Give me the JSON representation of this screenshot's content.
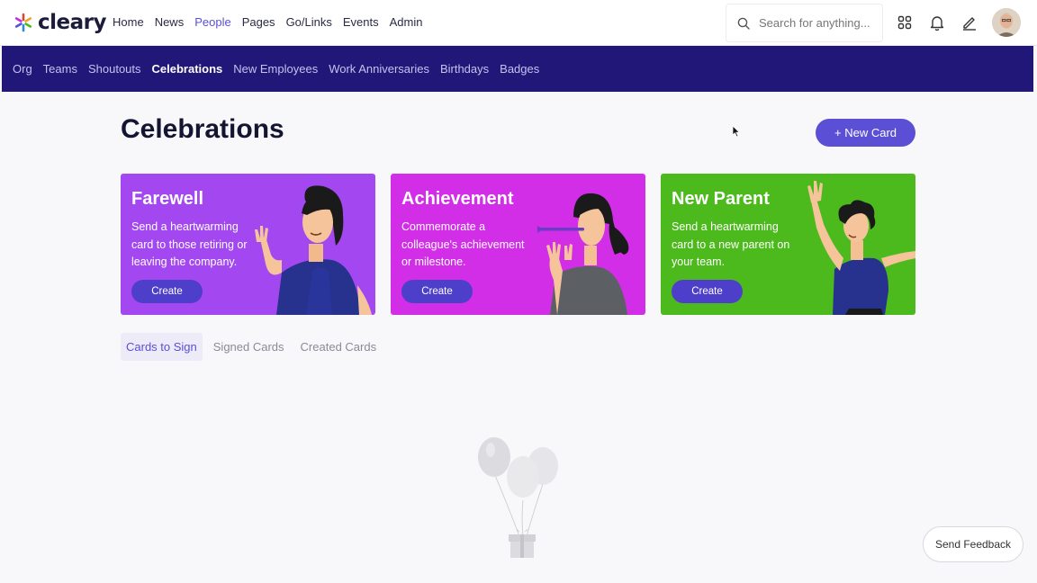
{
  "brand": {
    "name": "cleary",
    "accent": "#5b4fd6",
    "navbar_bg": "#201778"
  },
  "top_nav": [
    {
      "label": "Home",
      "active": false
    },
    {
      "label": "News",
      "active": false
    },
    {
      "label": "People",
      "active": true
    },
    {
      "label": "Pages",
      "active": false
    },
    {
      "label": "Go/Links",
      "active": false
    },
    {
      "label": "Events",
      "active": false
    },
    {
      "label": "Admin",
      "active": false
    }
  ],
  "search": {
    "placeholder": "Search for anything..."
  },
  "header_icons": [
    "apps-grid-icon",
    "bell-icon",
    "pencil-icon"
  ],
  "sub_nav": [
    {
      "label": "Org",
      "active": false
    },
    {
      "label": "Teams",
      "active": false
    },
    {
      "label": "Shoutouts",
      "active": false
    },
    {
      "label": "Celebrations",
      "active": true
    },
    {
      "label": "New Employees",
      "active": false
    },
    {
      "label": "Work Anniversaries",
      "active": false
    },
    {
      "label": "Birthdays",
      "active": false
    },
    {
      "label": "Badges",
      "active": false
    }
  ],
  "page": {
    "title": "Celebrations",
    "new_card_label": "+ New Card"
  },
  "cards": [
    {
      "title": "Farewell",
      "description": "Send a heartwarming card to those retiring or leaving the company.",
      "button": "Create",
      "color": "#a347f0"
    },
    {
      "title": "Achievement",
      "description": "Commemorate a colleague's achievement or milestone.",
      "button": "Create",
      "color": "#d22ee8"
    },
    {
      "title": "New Parent",
      "description": "Send a heartwarming card to a new parent on your team.",
      "button": "Create",
      "color": "#4cba1c"
    }
  ],
  "tabs": [
    {
      "label": "Cards to Sign",
      "active": true
    },
    {
      "label": "Signed Cards",
      "active": false
    },
    {
      "label": "Created Cards",
      "active": false
    }
  ],
  "feedback": {
    "label": "Send Feedback"
  }
}
